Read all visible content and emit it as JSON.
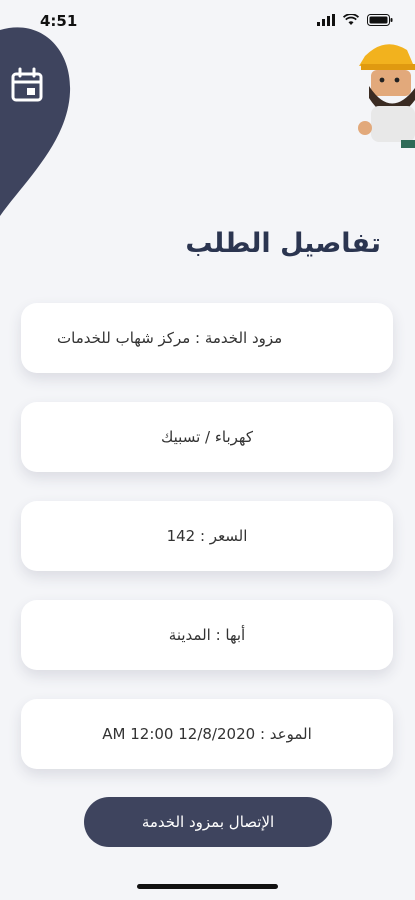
{
  "status": {
    "time": "4:51"
  },
  "header": {
    "title": "تفاصيل الطلب",
    "calendar_icon": "calendar-icon"
  },
  "details": {
    "provider": "مزود الخدمة : مركز شهاب للخدمات",
    "category": "كهرباء / تسبيك",
    "price": "السعر : 142",
    "city": "أبها : المدينة",
    "appointment": "الموعد : 12/8/2020 12:00 AM"
  },
  "actions": {
    "contact_label": "الإتصال بمزود الخدمة"
  },
  "colors": {
    "accent": "#3e445e",
    "title": "#2b3550",
    "background": "#f4f5f8"
  }
}
